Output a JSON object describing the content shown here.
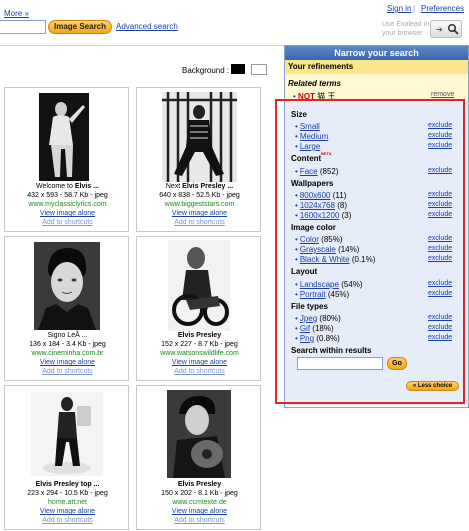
{
  "header": {
    "more_link": "More »",
    "sign_in": "Sign in",
    "separator": "|",
    "preferences": "Preferences",
    "search_value": "",
    "image_search_button": "Image Search",
    "advanced_search": "Advanced search",
    "exalead_hint": "Use Exalead in your browser"
  },
  "background_label": "Background :",
  "results": [
    {
      "title_prefix": "Welcome to ",
      "title_bold": "Elvis ...",
      "dims": "432 x 593 - 58.7 Kb - jpeg",
      "site": "www.myclassiclyrics.com",
      "view": "View image alone",
      "shortcut": "Add to shortcuts"
    },
    {
      "title_prefix": "Next ",
      "title_bold": "Elvis Presley ...",
      "dims": "640 x 838 - 52.5 Kb - jpeg",
      "site": "www.biggeststars.com",
      "view": "View image alone",
      "shortcut": "Add to shortcuts"
    },
    {
      "title_prefix": "Signo LeÃ ...",
      "title_bold": "",
      "dims": "136 x 184 - 3.4 Kb - jpeg",
      "site": "www.cineminha.com.br",
      "view": "View image alone",
      "shortcut": "Add to shortcuts"
    },
    {
      "title_prefix": "",
      "title_bold": "Elvis Presley",
      "dims": "152 x 227 - 8.7 Kb - jpeg",
      "site": "www.watsonswildlife.com",
      "view": "View image alone",
      "shortcut": "Add to shortcuts"
    },
    {
      "title_prefix": "",
      "title_bold": "Elvis Presley top ...",
      "dims": "223 x 294 - 10.5 Kb - jpeg",
      "site": "home.att.net",
      "view": "View image alone",
      "shortcut": "Add to shortcuts"
    },
    {
      "title_prefix": "",
      "title_bold": "Elvis Presley",
      "dims": "150 x 202 - 8.1 Kb - jpeg",
      "site": "www.ccmtexte.de",
      "view": "View image alone",
      "shortcut": "Add to shortcuts"
    }
  ],
  "panel": {
    "title": "Narrow your search",
    "refinements": "Your refinements",
    "related_terms": "Related terms",
    "not_label": "NOT",
    "not_term": "猫 王",
    "remove": "remove",
    "exclude": "exclude",
    "size": {
      "heading": "Size",
      "items": [
        "Small",
        "Medium",
        "Large"
      ]
    },
    "content": {
      "heading": "Content",
      "beta": "BETA",
      "items": [
        {
          "label": "Face",
          "count": "(852)"
        }
      ]
    },
    "wallpapers": {
      "heading": "Wallpapers",
      "items": [
        {
          "label": "800x600",
          "count": "(11)"
        },
        {
          "label": "1024x768",
          "count": "(8)"
        },
        {
          "label": "1600x1200",
          "count": "(3)"
        }
      ]
    },
    "image_color": {
      "heading": "Image color",
      "items": [
        {
          "label": "Color",
          "count": "(85%)"
        },
        {
          "label": "Grayscale",
          "count": "(14%)"
        },
        {
          "label": "Black & White",
          "count": "(0.1%)"
        }
      ]
    },
    "layout": {
      "heading": "Layout",
      "items": [
        {
          "label": "Landscape",
          "count": "(54%)"
        },
        {
          "label": "Portrait",
          "count": "(45%)"
        }
      ]
    },
    "file_types": {
      "heading": "File types",
      "items": [
        {
          "label": "Jpeg",
          "count": "(80%)"
        },
        {
          "label": "Gif",
          "count": "(18%)"
        },
        {
          "label": "Png",
          "count": "(0.8%)"
        }
      ]
    },
    "search_within": "Search within results",
    "search_within_value": "",
    "go": "Go",
    "less_choice": "« Less choice"
  },
  "colors": {
    "accent": "#f3a51c",
    "panel_header": "#3d66ad",
    "link": "#1a3fa8",
    "site": "#1a8a1a",
    "highlight_box": "#e0242b"
  }
}
